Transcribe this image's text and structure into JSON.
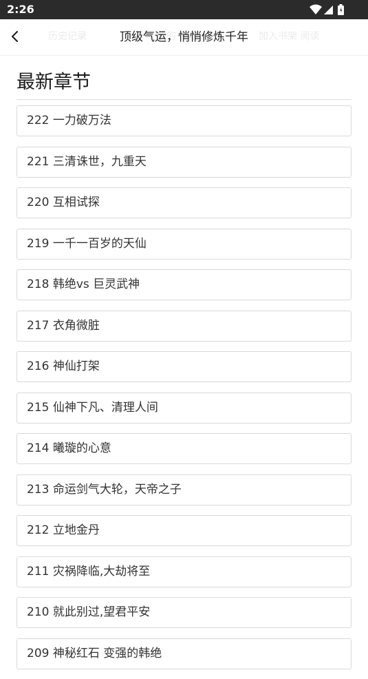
{
  "status_bar": {
    "time": "2:26",
    "icons": [
      "wifi-icon",
      "cellular-signal-icon",
      "battery-icon"
    ]
  },
  "header": {
    "back_icon": "chevron-left-icon",
    "title": "顶级气运，悄悄修炼千年",
    "ghost_texts": [
      "历史记录",
      "我的书架",
      "加入书架 阅读"
    ]
  },
  "section": {
    "heading": "最新章节"
  },
  "chapters": [
    "222 一力破万法",
    "221 三清诛世，九重天",
    "220 互相试探",
    "219 一千一百岁的天仙",
    "218 韩绝vs 巨灵武神",
    "217 衣角微脏",
    "216 神仙打架",
    "215 仙神下凡、清理人间",
    "214 曦璇的心意",
    "213 命运剑气大轮，天帝之子",
    "212 立地金丹",
    "211 灾祸降临,大劫将至",
    "210 就此别过,望君平安",
    "209 神秘红石 变强的韩绝"
  ],
  "colors": {
    "status_bar_bg": "#2b2b2b",
    "item_border": "#d9d9d9",
    "text": "#333333"
  }
}
